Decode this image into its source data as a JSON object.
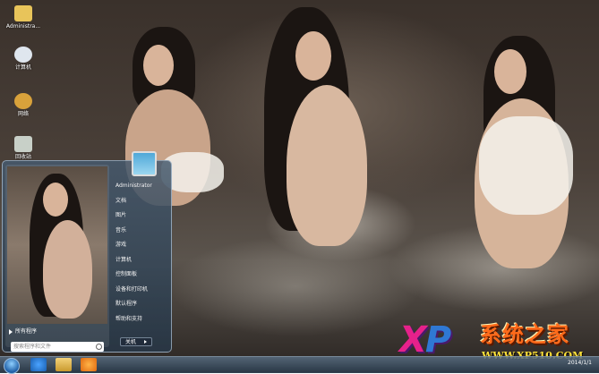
{
  "desktop": {
    "icons": [
      {
        "label": "Administra...",
        "icon": "folder-icon",
        "color": "#e8c45a"
      },
      {
        "label": "计算机",
        "icon": "computer-icon",
        "color": "#dfe6ee"
      },
      {
        "label": "网络",
        "icon": "network-icon",
        "color": "#d9a23b"
      },
      {
        "label": "回收站",
        "icon": "recycle-bin-icon",
        "color": "#c8d0c8"
      }
    ]
  },
  "start_menu": {
    "all_programs": "所有程序",
    "search_placeholder": "搜索程序和文件",
    "user_name": "Administrator",
    "items": [
      "文档",
      "图片",
      "音乐",
      "游戏",
      "计算机",
      "控制面板",
      "设备和打印机",
      "默认程序",
      "帮助和支持"
    ],
    "shutdown": "关机"
  },
  "taskbar": {
    "pinned": [
      "ie-icon",
      "explorer-icon",
      "media-player-icon"
    ],
    "clock": "2014/1/1"
  },
  "watermark": {
    "brand_letters": "XP",
    "brand_cn": "系统之家",
    "url": "WWW.XP510.COM"
  },
  "colors": {
    "brand_pink": "#e6218b",
    "brand_blue": "#2f78d4",
    "brand_orange": "#ff6a1a",
    "url_yellow": "#ffe23a"
  }
}
